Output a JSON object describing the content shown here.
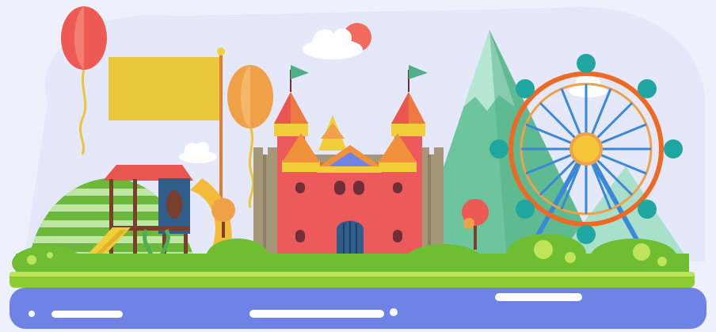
{
  "scene": {
    "kind": "flat-illustration",
    "elements": [
      "sky",
      "clouds",
      "sun",
      "balloons",
      "banner-flag",
      "mountains",
      "striped-hill",
      "playground",
      "slide",
      "tube-slide",
      "castle",
      "pennant-flags",
      "trees",
      "ferris-wheel",
      "bushes",
      "grass-strip",
      "river"
    ]
  },
  "colors": {
    "sky": "#eef1fb",
    "sky_blob": "#e3e7f8",
    "cloud": "#ffffff",
    "sun": "#f26b5e",
    "balloon_red": "#ee5a53",
    "balloon_orange": "#f0a046",
    "banner": "#e8c73a",
    "mountain_light": "#a9e0cc",
    "mountain": "#6cc59d",
    "mountain_dark": "#4fae85",
    "hill": "#6cb83b",
    "hill_stripe": "#bfe6a2",
    "castle_wall": "#ec5a5c",
    "castle_stone": "#a59777",
    "castle_roof": "#f0913c",
    "castle_trim": "#f2cf3a",
    "castle_dark": "#6f2f38",
    "gate": "#2f5d8c",
    "playground_roof": "#e8564f",
    "playground_frame": "#7a3f2c",
    "tube": "#f3bb3a",
    "wheel_orange": "#ee6a24",
    "wheel_blue": "#3a88d8",
    "wheel_hub": "#f5c63a",
    "cabin": "#1fa6a0",
    "grass": "#8ccd33",
    "grass_light": "#bde45b",
    "bush": "#6fbe32",
    "river": "#6f83e6",
    "river_light": "#ffffff"
  }
}
